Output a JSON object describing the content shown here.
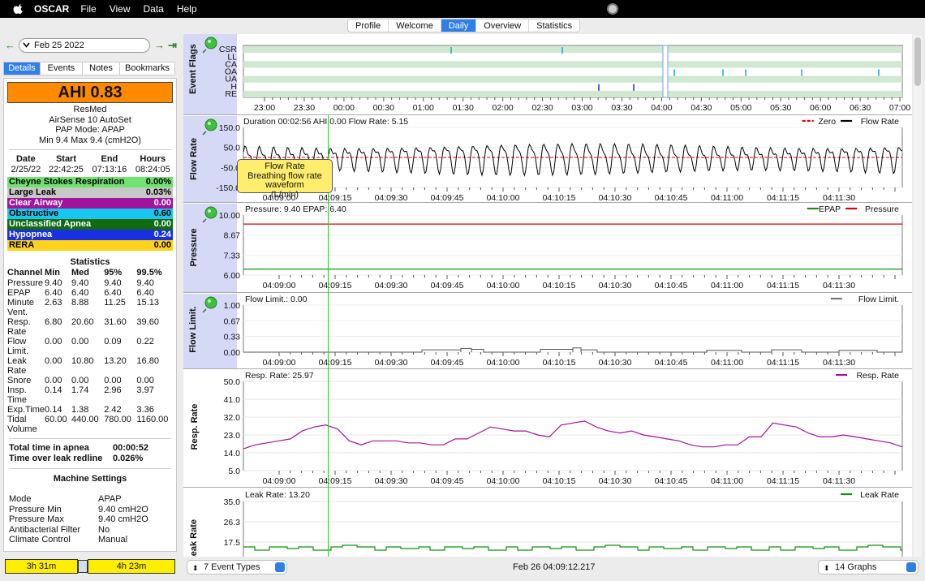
{
  "menubar": {
    "app_name": "OSCAR",
    "items": [
      "File",
      "View",
      "Data",
      "Help"
    ]
  },
  "top_tabs": [
    {
      "label": "Profile",
      "active": false
    },
    {
      "label": "Welcome",
      "active": false
    },
    {
      "label": "Daily",
      "active": true
    },
    {
      "label": "Overview",
      "active": false
    },
    {
      "label": "Statistics",
      "active": false
    }
  ],
  "date_nav": {
    "date": "Feb 25 2022"
  },
  "side_tabs": [
    {
      "label": "Details",
      "active": true
    },
    {
      "label": "Events",
      "active": false
    },
    {
      "label": "Notes",
      "active": false
    },
    {
      "label": "Bookmarks",
      "active": false
    }
  ],
  "summary": {
    "ahi": "AHI 0.83",
    "machine_lines": [
      "ResMed",
      "AirSense 10 AutoSet",
      "PAP Mode: APAP",
      "Min 9.4 Max 9.4 (cmH2O)"
    ]
  },
  "session": {
    "headers": [
      "Date",
      "Start",
      "End",
      "Hours"
    ],
    "row": [
      "2/25/22",
      "22:42:25",
      "07:13:16",
      "08:24:05"
    ]
  },
  "events": [
    {
      "name": "Cheyne Stokes Respiration",
      "value": "0.00%",
      "bg": "#6ee36e",
      "fg": "#000000"
    },
    {
      "name": "Large Leak",
      "value": "0.03%",
      "bg": "#c8c8c8",
      "fg": "#000000"
    },
    {
      "name": "Clear Airway",
      "value": "0.00",
      "bg": "#a0149c",
      "fg": "#ffffff"
    },
    {
      "name": "Obstructive",
      "value": "0.60",
      "bg": "#18c7f0",
      "fg": "#000000"
    },
    {
      "name": "Unclassified Apnea",
      "value": "0.00",
      "bg": "#106a10",
      "fg": "#ffffff"
    },
    {
      "name": "Hypopnea",
      "value": "0.24",
      "bg": "#1830e0",
      "fg": "#ffffff"
    },
    {
      "name": "RERA",
      "value": "0.00",
      "bg": "#ffd21c",
      "fg": "#000000"
    }
  ],
  "statistics": {
    "title": "Statistics",
    "headers": [
      "Channel",
      "Min",
      "Med",
      "95%",
      "99.5%"
    ],
    "rows": [
      [
        "Pressure",
        "9.40",
        "9.40",
        "9.40",
        "9.40"
      ],
      [
        "EPAP",
        "6.40",
        "6.40",
        "6.40",
        "6.40"
      ],
      [
        "Minute Vent.",
        "2.63",
        "8.88",
        "11.25",
        "15.13"
      ],
      [
        "Resp. Rate",
        "6.80",
        "20.60",
        "31.60",
        "39.60"
      ],
      [
        "Flow Limit.",
        "0.00",
        "0.00",
        "0.09",
        "0.22"
      ],
      [
        "Leak Rate",
        "0.00",
        "10.80",
        "13.20",
        "16.80"
      ],
      [
        "Snore",
        "0.00",
        "0.00",
        "0.00",
        "0.00"
      ],
      [
        "Insp. Time",
        "0.14",
        "1.74",
        "2.96",
        "3.97"
      ],
      [
        "Exp.Time",
        "0.14",
        "1.38",
        "2.42",
        "3.36"
      ],
      [
        "Tidal Volume",
        "60.00",
        "440.00",
        "780.00",
        "1160.00"
      ]
    ]
  },
  "apnea": [
    {
      "label": "Total time in apnea",
      "value": "00:00:52"
    },
    {
      "label": "Time over leak redline",
      "value": "0.026%"
    }
  ],
  "machine_settings": {
    "title": "Machine Settings",
    "rows": [
      {
        "label": "Mode",
        "value": "APAP"
      },
      {
        "label": "Pressure Min",
        "value": "9.40 cmH2O"
      },
      {
        "label": "Pressure Max",
        "value": "9.40 cmH2O"
      },
      {
        "label": "Antibacterial Filter",
        "value": "No"
      },
      {
        "label": "Climate Control",
        "value": "Manual"
      }
    ]
  },
  "time_bars": {
    "left": "3h 31m",
    "right": "4h 23m"
  },
  "graphs": {
    "event_flags": {
      "title": "Event Flags",
      "rows": [
        "CSR",
        "LL",
        "CA",
        "OA",
        "UA",
        "H",
        "RE"
      ],
      "ticks": [
        "23:00",
        "23:30",
        "00:00",
        "00:30",
        "01:00",
        "01:30",
        "02:00",
        "02:30",
        "03:00",
        "03:30",
        "04:00",
        "04:30",
        "05:00",
        "05:30",
        "06:00",
        "06:30",
        "07:00"
      ]
    },
    "time_ticks": [
      "04:09:00",
      "04:09:15",
      "04:09:30",
      "04:09:45",
      "04:10:00",
      "04:10:15",
      "04:10:30",
      "04:10:45",
      "04:11:00",
      "04:11:15",
      "04:11:30"
    ],
    "flow_rate": {
      "title": "Flow Rate",
      "header": "Duration 00:02:56 AHI 0.00 Flow Rate: 5.15",
      "legend": [
        "Zero",
        "Flow Rate"
      ],
      "yticks": [
        "150.0",
        "50.0",
        "-50.0",
        "-150.0"
      ]
    },
    "pressure": {
      "title": "Pressure",
      "header": "Pressure: 9.40 EPAP: 6.40",
      "legend": [
        "EPAP",
        "Pressure"
      ],
      "yticks": [
        "10.00",
        "8.67",
        "7.33",
        "6.00"
      ],
      "pressure_value": 9.4,
      "epap_value": 6.4
    },
    "flow_limit": {
      "title": "Flow Limit.",
      "header": "Flow Limit.: 0.00",
      "legend": [
        "Flow Limit."
      ],
      "yticks": [
        "1.00",
        "0.67",
        "0.33",
        "0.00"
      ]
    },
    "resp_rate": {
      "title": "Resp. Rate",
      "header": "Resp. Rate: 25.97",
      "legend": [
        "Resp. Rate"
      ],
      "yticks": [
        "50.0",
        "41.0",
        "32.0",
        "23.0",
        "14.0",
        "5.0"
      ],
      "ymin": 5,
      "ymax": 50,
      "values": [
        16,
        18,
        19,
        20,
        21,
        25,
        27,
        28,
        26,
        20,
        18,
        20,
        20,
        20,
        19,
        19,
        18,
        18,
        21,
        21,
        24,
        27,
        26,
        25,
        25,
        23,
        22,
        28,
        29,
        30,
        27,
        25,
        24,
        25,
        23,
        22,
        21,
        20,
        18,
        17,
        17,
        18,
        18,
        22,
        22,
        29,
        28,
        27,
        24,
        22,
        22,
        23,
        22,
        21,
        20,
        19,
        17
      ]
    },
    "leak_rate": {
      "title": "Leak Rate",
      "header": "Leak Rate: 13.20",
      "legend": [
        "Leak Rate"
      ],
      "yticks": [
        "35.0",
        "26.3",
        "17.5"
      ]
    }
  },
  "tooltip": {
    "lines": [
      "Flow Rate",
      "Breathing flow rate waveform",
      "(L/min)"
    ]
  },
  "bottom_bar": {
    "event_types": "7 Event Types",
    "timestamp": "Feb 26 04:09:12.217",
    "graphs": "14 Graphs"
  }
}
